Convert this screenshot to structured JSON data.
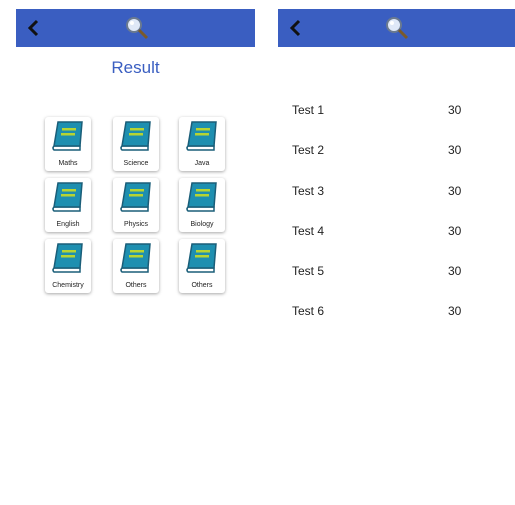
{
  "left": {
    "result_title": "Result",
    "subjects": [
      "Maths",
      "Science",
      "Java",
      "English",
      "Physics",
      "Biology",
      "Chemistry",
      "Others",
      "Others"
    ]
  },
  "right": {
    "tests": [
      {
        "name": "Test 1",
        "score": "30"
      },
      {
        "name": "Test 2",
        "score": "30"
      },
      {
        "name": "Test 3",
        "score": "30"
      },
      {
        "name": "Test 4",
        "score": "30"
      },
      {
        "name": "Test 5",
        "score": "30"
      },
      {
        "name": "Test 6",
        "score": "30"
      }
    ]
  },
  "colors": {
    "accent": "#3a5ec1",
    "book": "#1e8fb0",
    "book_stripe": "#b7d432"
  },
  "icons": {
    "back": "back-arrow-icon",
    "logo": "magnifier-logo-icon",
    "subject": "book-icon"
  }
}
